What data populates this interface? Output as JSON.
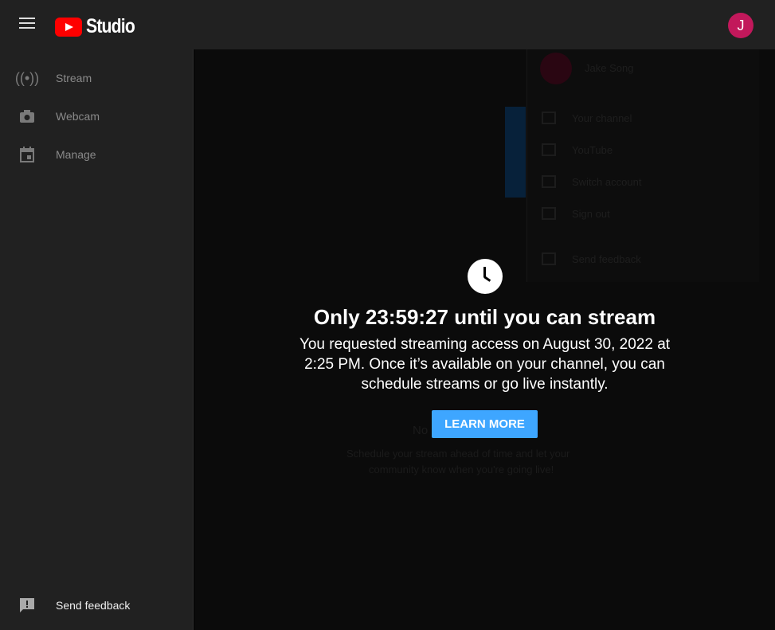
{
  "header": {
    "logo_text": "Studio",
    "avatar_initial": "J"
  },
  "sidebar": {
    "items": [
      {
        "label": "Stream",
        "icon": "broadcast-icon"
      },
      {
        "label": "Webcam",
        "icon": "camera-icon"
      },
      {
        "label": "Manage",
        "icon": "calendar-icon"
      }
    ],
    "feedback": "Send feedback"
  },
  "account_menu": {
    "name": "Jake Song",
    "items": [
      "Your channel",
      "YouTube",
      "Switch account",
      "Sign out",
      "Send feedback"
    ]
  },
  "background": {
    "title": "No upcoming streams",
    "text1": "Schedule your stream ahead of time and let your",
    "text2": "community know when you're going live!"
  },
  "dialog": {
    "title": "Only 23:59:27 until you can stream",
    "description": "You requested streaming access on August 30, 2022 at 2:25 PM. Once it’s available on your channel, you can schedule streams or go live instantly.",
    "button": "LEARN MORE"
  },
  "colors": {
    "accent": "#3ea6ff",
    "avatar": "#c2185b",
    "brand": "#ff0000"
  }
}
